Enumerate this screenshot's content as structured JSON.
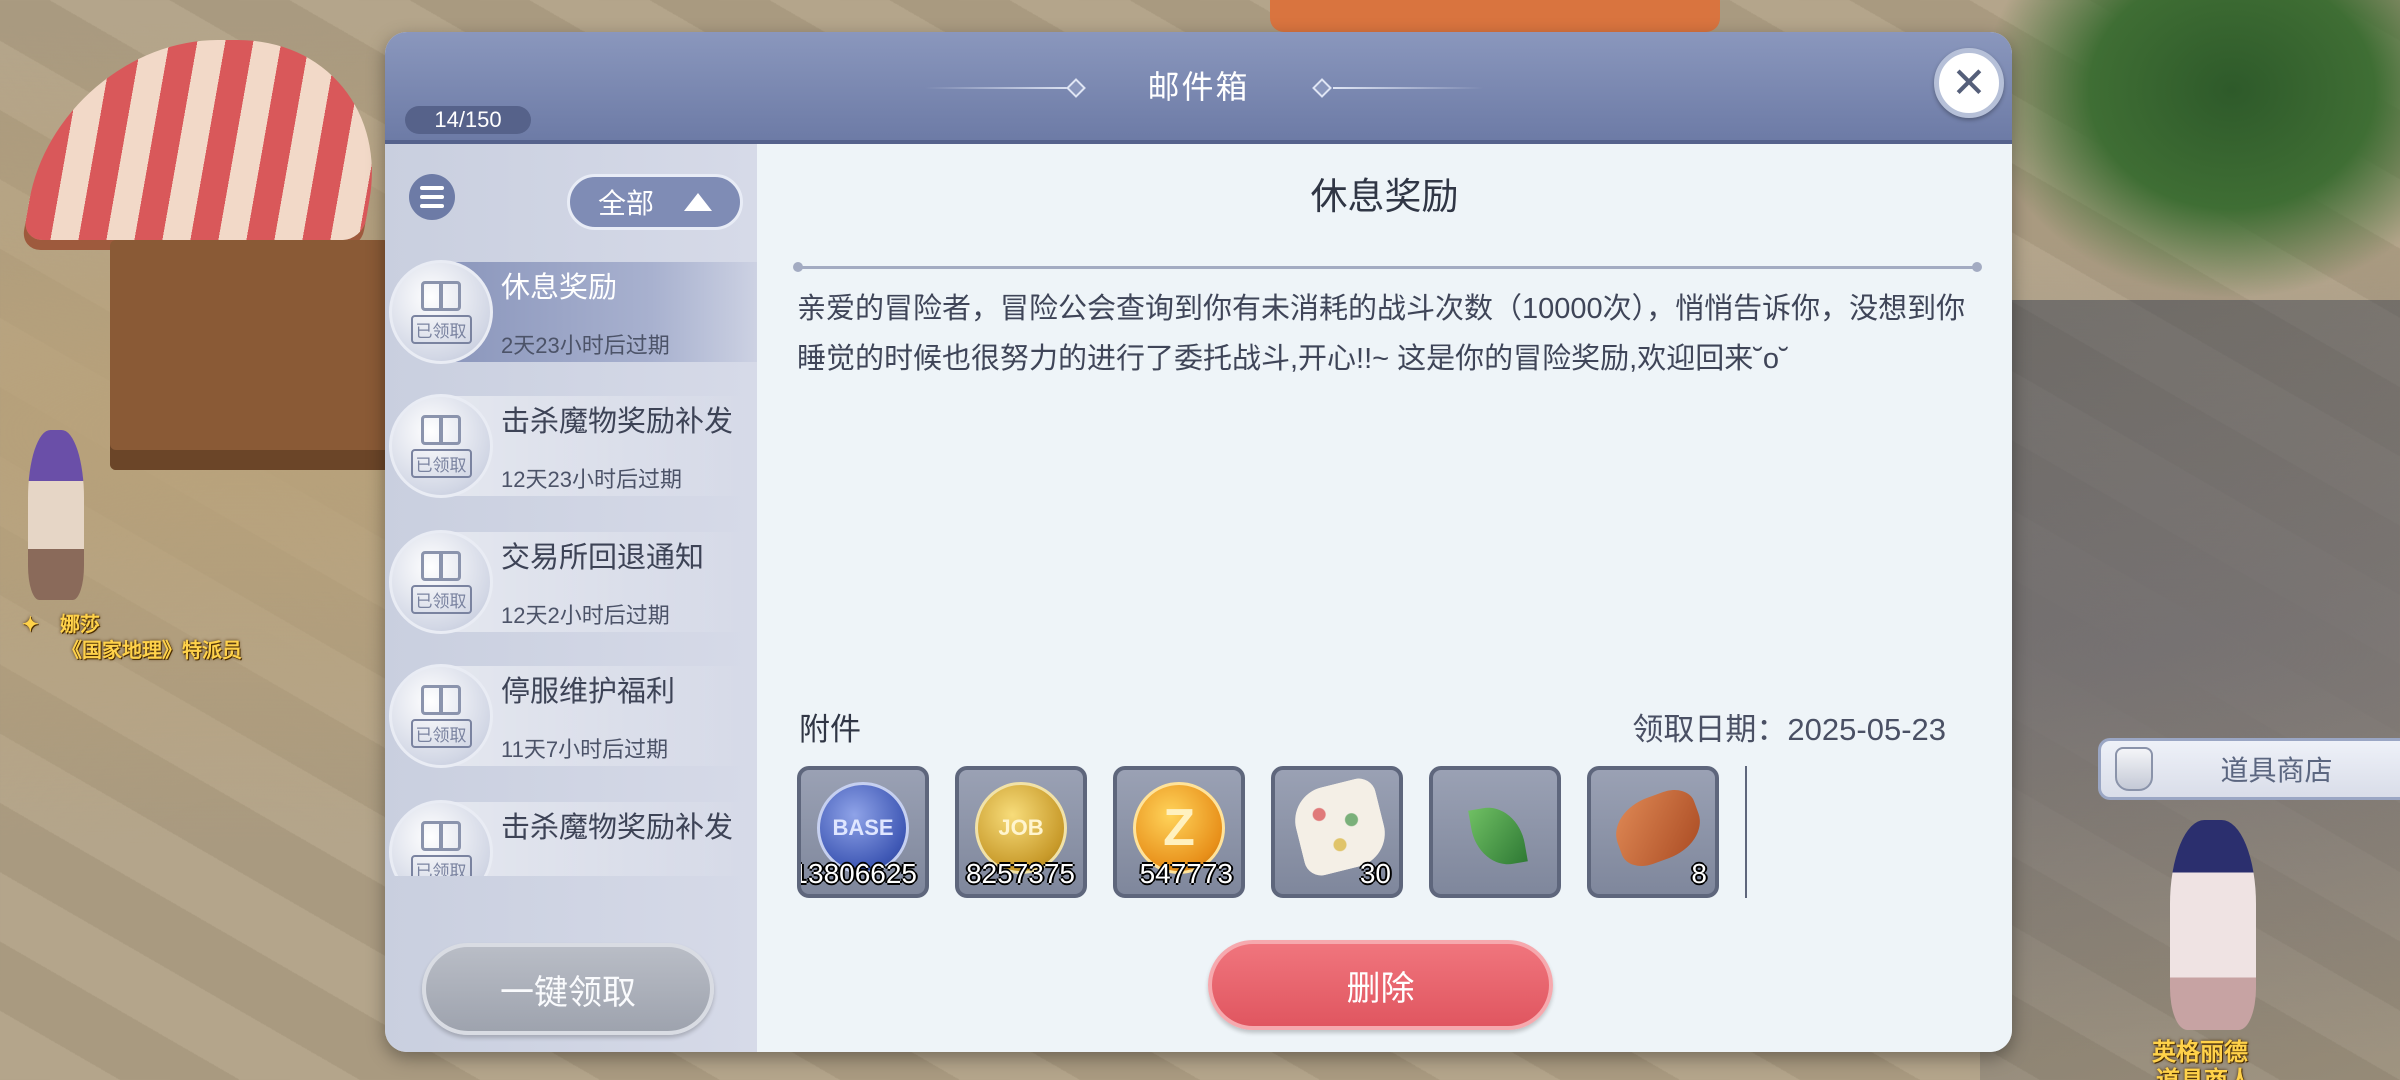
{
  "mailbox": {
    "title": "邮件箱",
    "count": "14/150",
    "close_icon": "close-icon",
    "filter_label": "全部",
    "claim_all_label": "一键领取",
    "mails": [
      {
        "title": "休息奖励",
        "expire": "2天23小时后过期",
        "stamp": "已领取",
        "selected": true
      },
      {
        "title": "击杀魔物奖励补发",
        "expire": "12天23小时后过期",
        "stamp": "已领取",
        "selected": false
      },
      {
        "title": "交易所回退通知",
        "expire": "12天2小时后过期",
        "stamp": "已领取",
        "selected": false
      },
      {
        "title": "停服维护福利",
        "expire": "11天7小时后过期",
        "stamp": "已领取",
        "selected": false
      },
      {
        "title": "击杀魔物奖励补发",
        "expire": "",
        "stamp": "已领取",
        "selected": false
      }
    ]
  },
  "detail": {
    "title": "休息奖励",
    "body": "亲爱的冒险者，冒险公会查询到你有未消耗的战斗次数（10000次），悄悄告诉你，没想到你睡觉的时候也很努力的进行了委托战斗,开心!!~ 这是你的冒险奖励,欢迎回来˘o˘",
    "attachments_label": "附件",
    "claim_date": "领取日期：2025-05-23",
    "attachments": [
      {
        "icon": "base-exp-icon",
        "coin_text": "BASE",
        "qty": "13806625"
      },
      {
        "icon": "job-exp-icon",
        "coin_text": "JOB",
        "qty": "8257375"
      },
      {
        "icon": "zeny-coin-icon",
        "coin_text": "Z",
        "qty": "547773"
      },
      {
        "icon": "cloth-item-icon",
        "coin_text": "",
        "qty": "30"
      },
      {
        "icon": "leaf-item-icon",
        "coin_text": "",
        "qty": ""
      },
      {
        "icon": "meat-item-icon",
        "coin_text": "",
        "qty": "8"
      }
    ],
    "delete_label": "删除"
  },
  "scene": {
    "shop_label": "道具商店",
    "npc_left_name": "娜莎",
    "npc_left_title": "《国家地理》特派员",
    "npc_right_name": "英格丽德",
    "npc_right_title": "道具商人"
  },
  "colors": {
    "header": "#7583ab",
    "sidebar": "#cfd4e3",
    "content": "#eef4f8",
    "delete": "#e8636b",
    "npc_label": "#ffd24a"
  }
}
